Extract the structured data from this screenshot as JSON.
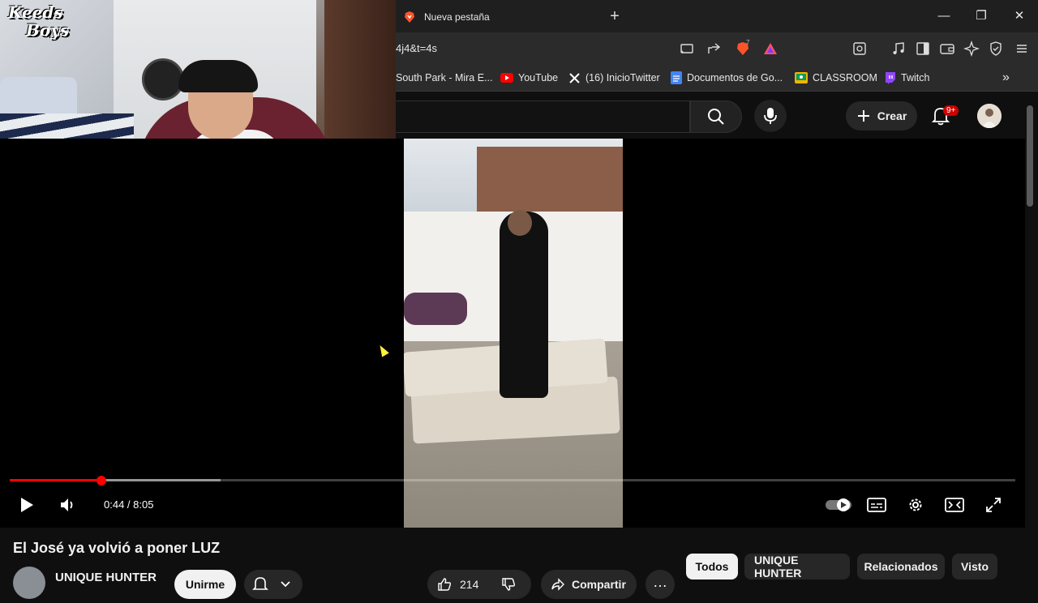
{
  "browser": {
    "tab_title": "Nueva pestaña",
    "new_tab_symbol": "+",
    "window_controls": {
      "minimize": "—",
      "restore": "❐",
      "close": "✕"
    },
    "url_fragment": "4j4&t=4s",
    "bookmarks": [
      {
        "label": "South Park - Mira E...",
        "icon": "southpark-icon",
        "color": "#2b2b2b"
      },
      {
        "label": "YouTube",
        "icon": "youtube-icon",
        "color": "#ff0000"
      },
      {
        "label": "(16) InicioTwitter",
        "icon": "x-icon",
        "color": "#000000"
      },
      {
        "label": "Documentos de Go...",
        "icon": "docs-icon",
        "color": "#4285f4"
      },
      {
        "label": "CLASSROOM",
        "icon": "classroom-icon",
        "color": "#f4b400"
      },
      {
        "label": "Twitch",
        "icon": "twitch-icon",
        "color": "#9146ff"
      }
    ],
    "bookmarks_overflow": "»",
    "shield_badge": "7"
  },
  "webcam": {
    "logo_line1": "Keeds",
    "logo_line2": "Boys"
  },
  "youtube": {
    "create_label": "Crear",
    "notifications_badge": "9+",
    "player": {
      "current_time": "0:44",
      "duration": "8:05",
      "time_display": "0:44 / 8:05",
      "played_fraction": 0.091,
      "buffered_fraction": 0.21
    },
    "video_title": "El José ya volvió a poner LUZ",
    "channel_name": "UNIQUE HUNTER",
    "join_label": "Unirme",
    "like_count": "214",
    "share_label": "Compartir",
    "more_label": "…",
    "filter_chips": [
      {
        "label": "Todos",
        "active": true
      },
      {
        "label": "UNIQUE HUNTER",
        "active": false
      },
      {
        "label": "Relacionados",
        "active": false
      },
      {
        "label": "Visto",
        "active": false
      }
    ]
  },
  "colors": {
    "progress_played": "#ff0000",
    "youtube_bg": "#0f0f0f",
    "notification_badge": "#cc0000"
  }
}
